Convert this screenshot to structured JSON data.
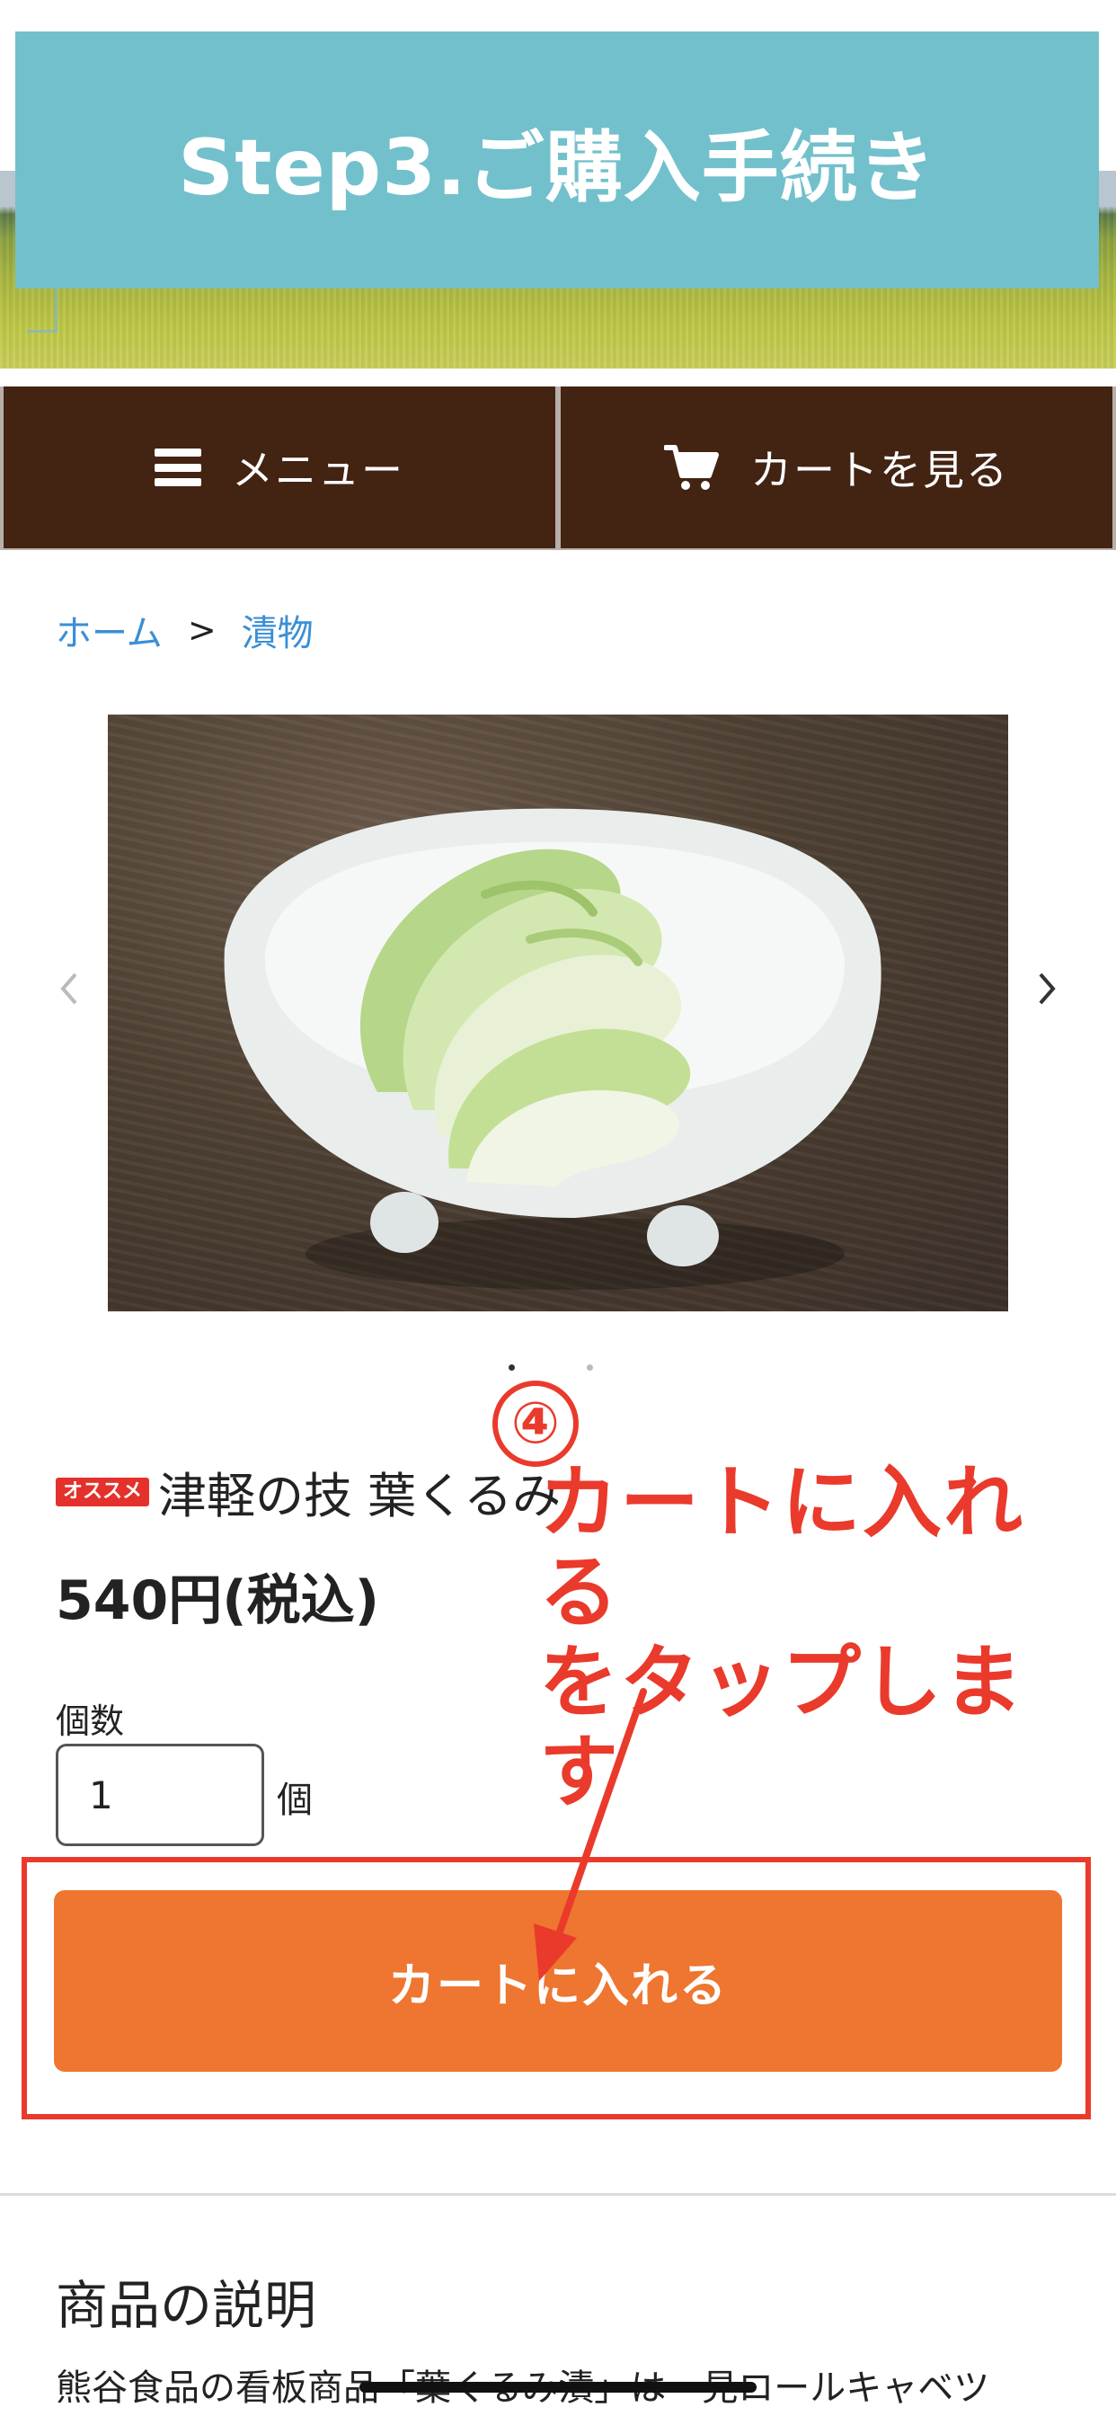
{
  "banner": {
    "title": "Step3.ご購入手続き"
  },
  "nav": {
    "menu_label": "メニュー",
    "cart_label": "カートを見る"
  },
  "breadcrumb": {
    "home": "ホーム",
    "separator": ">",
    "category": "漬物"
  },
  "product": {
    "badge": "オススメ",
    "name": "津軽の技 葉くるみ",
    "price": "540円(税込)",
    "quantity_label": "個数",
    "quantity_value": "1",
    "quantity_unit": "個",
    "add_to_cart": "カートに入れる",
    "carousel_total": 2,
    "carousel_current": 1
  },
  "annotation": {
    "step_number": "④",
    "line1": "カートに入れる",
    "line2": "をタップします"
  },
  "description": {
    "heading": "商品の説明",
    "text": "熊谷食品の看板商品「葉くるみ漬」は一見ロールキャベツ"
  },
  "colors": {
    "banner": "#72c0cc",
    "nav_bg": "#432312",
    "link": "#3a8fd6",
    "cta": "#ee7630",
    "annotation": "#ea3a2c"
  },
  "icons": {
    "menu": "hamburger-icon",
    "cart": "cart-icon",
    "prev": "chevron-left-icon",
    "next": "chevron-right-icon"
  }
}
